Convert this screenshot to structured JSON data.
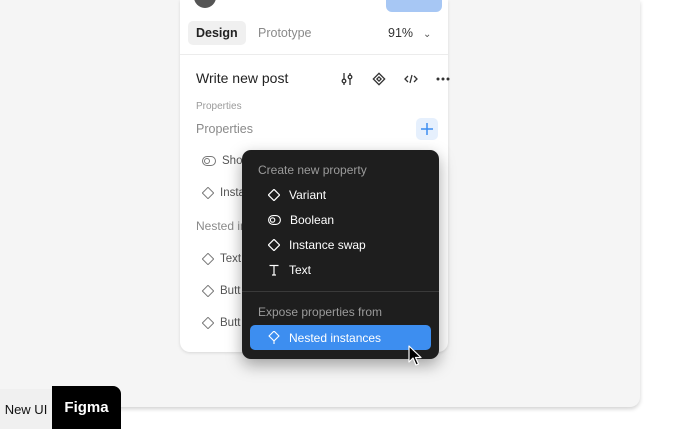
{
  "tabs": {
    "design": "Design",
    "prototype": "Prototype"
  },
  "zoom": {
    "value": "91%"
  },
  "component": {
    "title": "Write new post"
  },
  "properties": {
    "small_label": "Properties",
    "section_label": "Properties",
    "rows": [
      "Sho",
      "Insta"
    ]
  },
  "nested": {
    "label": "Nested in",
    "rows": [
      "Text",
      "Butt",
      "Butt"
    ]
  },
  "menu": {
    "create_header": "Create new property",
    "items": [
      "Variant",
      "Boolean",
      "Instance swap",
      "Text"
    ],
    "expose_header": "Expose properties from",
    "nested_item": "Nested instances"
  },
  "badges": {
    "new_ui": "New UI",
    "figma": "Figma"
  },
  "colors": {
    "accent": "#3d8ef0",
    "menu_bg": "#1e1e1e",
    "plus_bg": "#e6f0fd"
  }
}
